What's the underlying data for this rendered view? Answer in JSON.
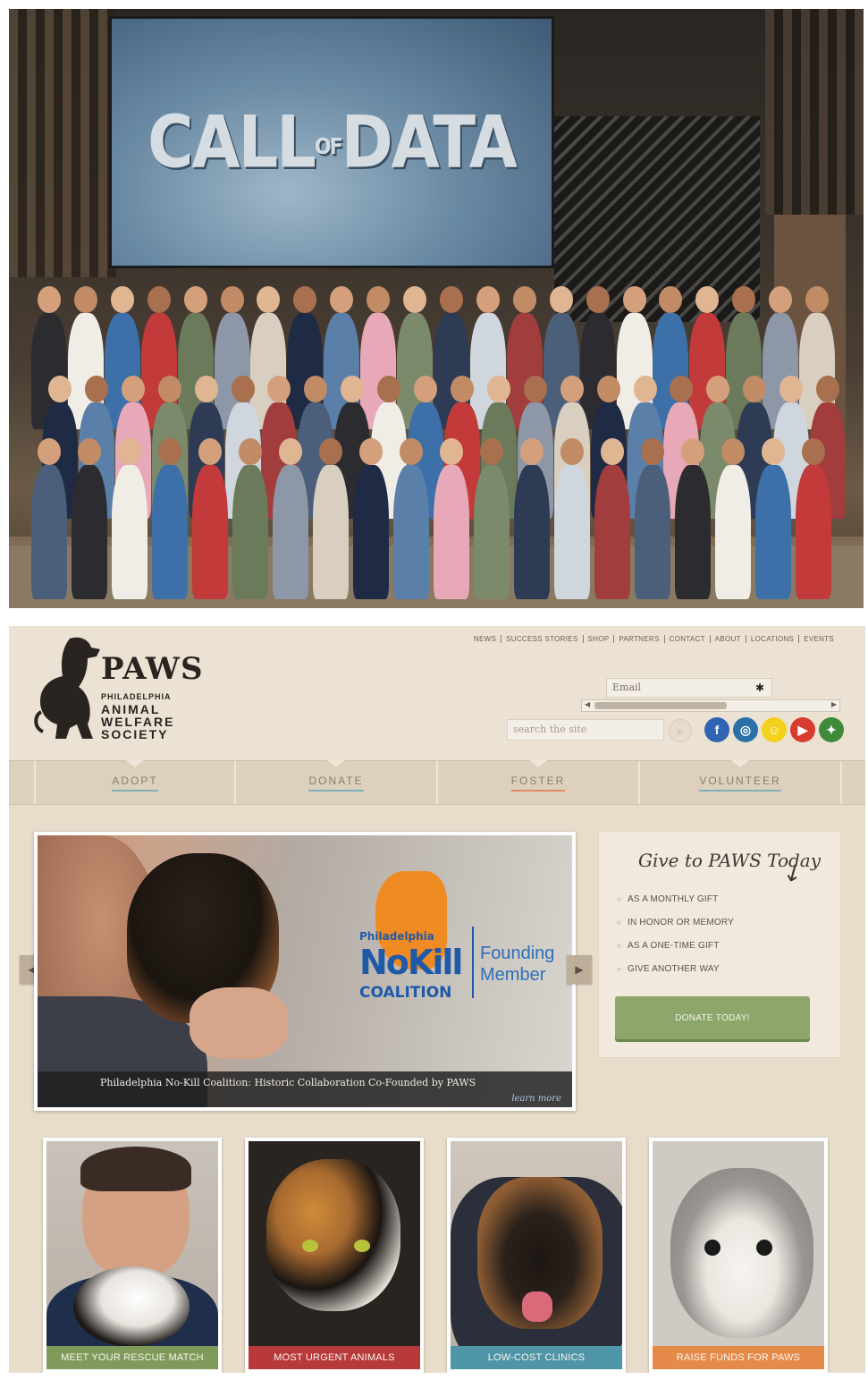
{
  "event_photo": {
    "screen_text": "CALL of DATA",
    "screen_word_1": "CALL",
    "screen_word_small": "OF",
    "screen_word_2": "DATA"
  },
  "paws": {
    "logo": {
      "title": "PAWS",
      "line1": "PHILADELPHIA",
      "line2": "ANIMAL",
      "line3": "WELFARE",
      "line4": "SOCIETY"
    },
    "top_links": [
      "NEWS",
      "SUCCESS STORIES",
      "SHOP",
      "PARTNERS",
      "CONTACT",
      "ABOUT",
      "LOCATIONS",
      "EVENTS"
    ],
    "email_placeholder": "Email",
    "email_required_mark": "✱",
    "search_placeholder": "search the site",
    "social": [
      {
        "name": "facebook-icon",
        "glyph": "f",
        "color": "#2f63b3"
      },
      {
        "name": "instagram-icon",
        "glyph": "◎",
        "color": "#2a6fa8"
      },
      {
        "name": "snapchat-icon",
        "glyph": "☺",
        "color": "#f2d01c"
      },
      {
        "name": "youtube-icon",
        "glyph": "▶",
        "color": "#d93a2e"
      },
      {
        "name": "twitter-icon",
        "glyph": "✦",
        "color": "#3e8a3a"
      }
    ],
    "nav": [
      {
        "label": "ADOPT",
        "underline": "#7fb0b8"
      },
      {
        "label": "DONATE",
        "underline": "#7fb0b8"
      },
      {
        "label": "FOSTER",
        "underline": "#e08a6a"
      },
      {
        "label": "VOLUNTEER",
        "underline": "#7fb0b8"
      }
    ],
    "slider": {
      "nk_line1": "Philadelphia",
      "nk_line2": "NoKill",
      "nk_line3": "COALITION",
      "nk_founding1": "Founding",
      "nk_founding2": "Member",
      "caption": "Philadelphia No-Kill Coalition: Historic Collaboration Co-Founded by PAWS",
      "learn_more": "learn more",
      "prev": "◀",
      "next": "▶"
    },
    "give": {
      "title": "Give to PAWS Today",
      "arrow": "↙",
      "options": [
        "AS A MONTHLY GIFT",
        "IN HONOR OR MEMORY",
        "AS A ONE-TIME GIFT",
        "GIVE ANOTHER WAY"
      ],
      "button": "DONATE TODAY!"
    },
    "tiles": [
      {
        "label": "MEET YOUR RESCUE MATCH",
        "color": "#7f9a5b"
      },
      {
        "label": "MOST URGENT ANIMALS",
        "color": "#b8393a"
      },
      {
        "label": "LOW-COST CLINICS",
        "color": "#4f95a8"
      },
      {
        "label": "RAISE FUNDS FOR PAWS",
        "color": "#e58a48"
      }
    ]
  }
}
